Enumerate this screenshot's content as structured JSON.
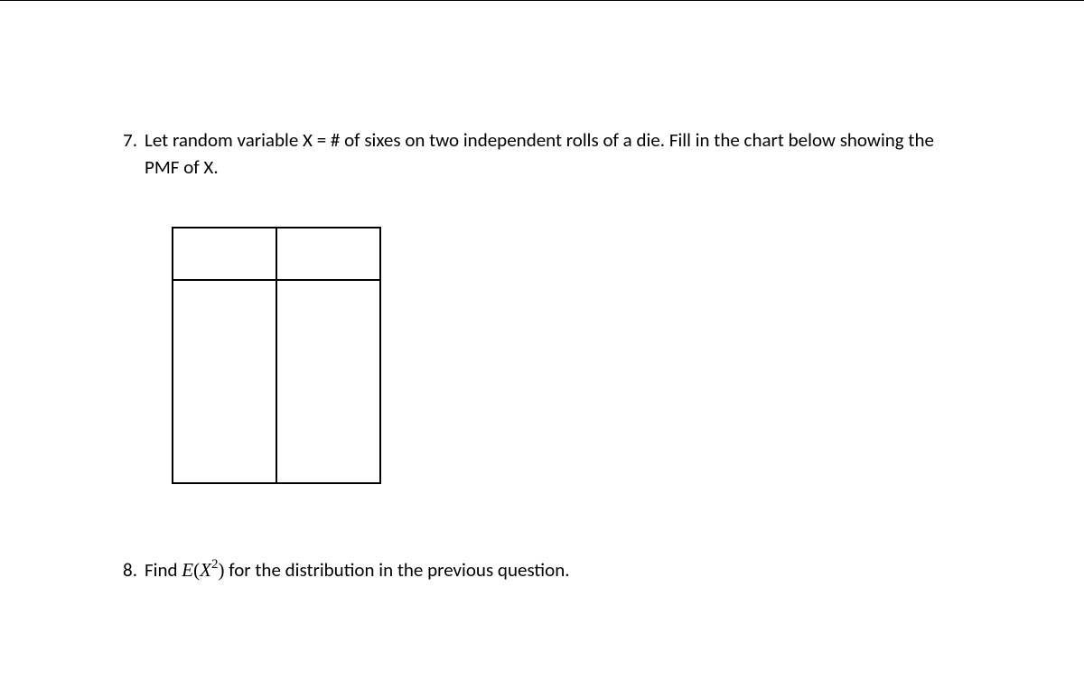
{
  "questions": {
    "q7": {
      "number": "7.",
      "text": "Let random variable X = # of sixes on two independent rolls of a die. Fill in the chart below showing the PMF of X."
    },
    "q8": {
      "number": "8.",
      "text_before": "Find ",
      "math_E": "E",
      "math_paren_open": "(",
      "math_X": "X",
      "math_sup": "2",
      "math_paren_close": ")",
      "text_after": " for the distribution in the previous question."
    }
  }
}
